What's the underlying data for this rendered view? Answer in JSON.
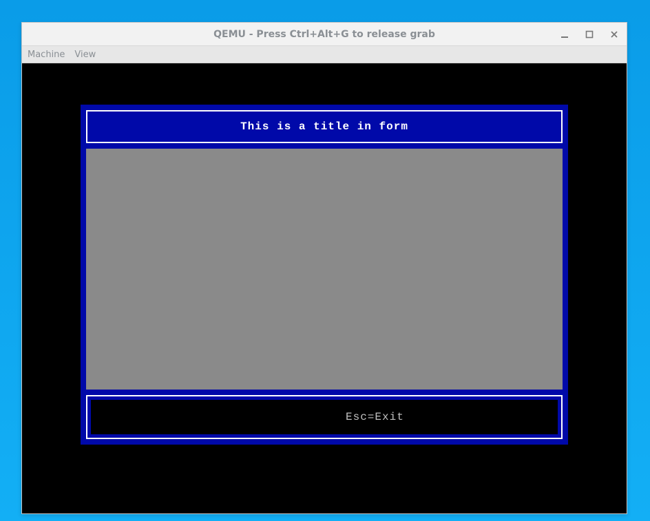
{
  "window": {
    "title": "QEMU - Press Ctrl+Alt+G to release grab"
  },
  "menubar": {
    "machine": "Machine",
    "view": "View"
  },
  "form": {
    "title": "This is a title in form",
    "footer_hint": "Esc=Exit"
  }
}
